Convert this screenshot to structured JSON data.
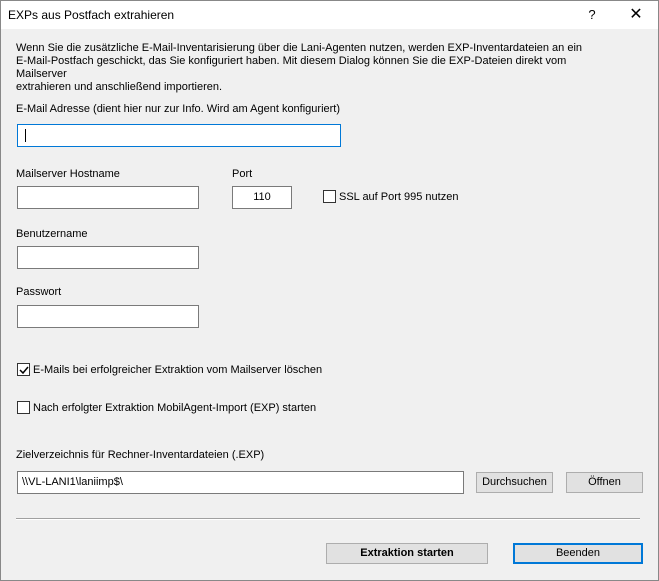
{
  "window": {
    "title": "EXPs aus Postfach extrahieren",
    "help_label": "?",
    "close_label": "✕"
  },
  "intro_text": {
    "line1": "Wenn Sie die zusätzliche E-Mail-Inventarisierung über die Lani-Agenten nutzen, werden EXP-Inventardateien an ein",
    "line2": "E-Mail-Postfach geschickt, das Sie konfiguriert haben. Mit diesem Dialog können Sie die EXP-Dateien direkt vom Mailserver",
    "line3": "extrahieren und anschließend importieren."
  },
  "email": {
    "label": "E-Mail Adresse (dient hier nur zur Info. Wird am Agent konfiguriert)",
    "value": ""
  },
  "mailserver": {
    "label": "Mailserver Hostname",
    "value": ""
  },
  "port": {
    "label": "Port",
    "value": "110"
  },
  "ssl": {
    "label": "SSL auf Port 995 nutzen",
    "checked": false
  },
  "username": {
    "label": "Benutzername",
    "value": ""
  },
  "password": {
    "label": "Passwort",
    "value": ""
  },
  "delete_mails": {
    "label": "E-Mails bei erfolgreicher Extraktion vom Mailserver löschen",
    "checked": true
  },
  "mobil_import": {
    "label": "Nach erfolgter Extraktion MobilAgent-Import (EXP) starten",
    "checked": false
  },
  "target_dir": {
    "label": "Zielverzeichnis für Rechner-Inventardateien (.EXP)",
    "value": "\\\\VL-LANI1\\laniimp$\\",
    "browse_label": "Durchsuchen",
    "open_label": "Öffnen"
  },
  "footer": {
    "start_label": "Extraktion starten",
    "close_label": "Beenden"
  },
  "colors": {
    "window_bg": "#f0f0f0",
    "focus_border": "#0078d7",
    "button_bg": "#e1e1e1"
  }
}
